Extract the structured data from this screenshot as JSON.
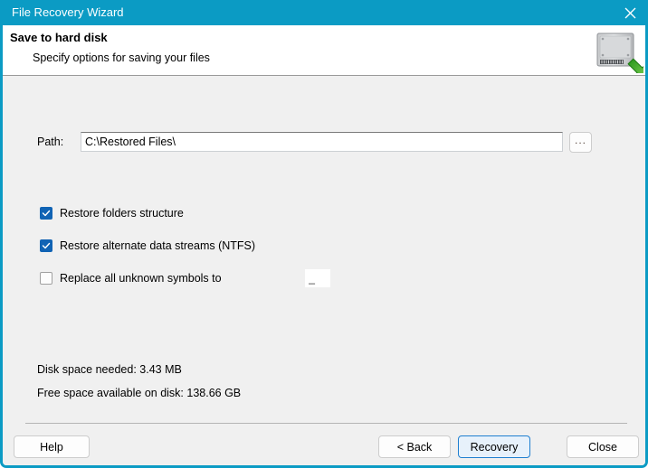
{
  "window": {
    "title": "File Recovery Wizard",
    "accent_color": "#0b9bc4",
    "close_icon": "close-icon"
  },
  "header": {
    "title": "Save to hard disk",
    "subtitle": "Specify options for saving your files",
    "icon": "hard-disk-save-icon"
  },
  "form": {
    "path_label": "Path:",
    "path_value": "C:\\Restored Files\\",
    "path_placeholder": "",
    "browse_label": "...",
    "checkboxes": [
      {
        "label": "Restore folders structure",
        "checked": true
      },
      {
        "label": "Restore alternate data streams (NTFS)",
        "checked": true
      },
      {
        "label": "Replace all unknown symbols to",
        "checked": false
      }
    ],
    "replace_symbol_value": "_"
  },
  "info": {
    "disk_space_needed": "Disk space needed: 3.43 MB",
    "free_space_available": "Free space available on disk: 138.66 GB"
  },
  "footer": {
    "help_label": "Help",
    "back_label": "< Back",
    "recovery_label": "Recovery",
    "close_label": "Close",
    "default_button_color": "#1f7fd0"
  }
}
